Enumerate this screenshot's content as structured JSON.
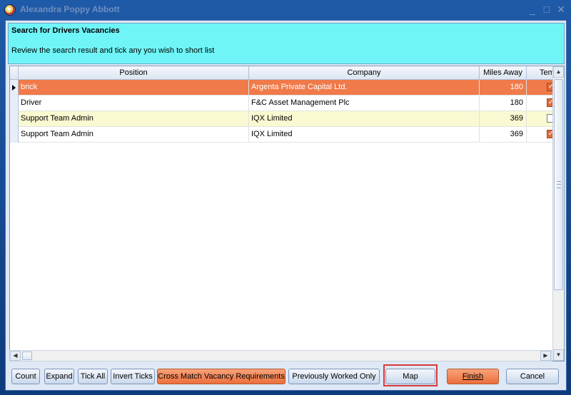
{
  "window": {
    "title": "Alexandra Poppy Abbott",
    "controls": [
      "_",
      "□",
      "✕"
    ]
  },
  "header": {
    "title": "Search for Drivers Vacancies",
    "subtitle": "Review the search result and tick any you wish to short list"
  },
  "grid": {
    "columns": [
      "Position",
      "Company",
      "Miles Away",
      "Tem"
    ],
    "rows": [
      {
        "position": "brick",
        "company": "Argenta Private Capital Ltd.",
        "miles": "180",
        "ticked": true,
        "selected": true
      },
      {
        "position": "Driver",
        "company": "F&C Asset Management Plc",
        "miles": "180",
        "ticked": true,
        "selected": false
      },
      {
        "position": "Support Team Admin",
        "company": "IQX Limited",
        "miles": "369",
        "ticked": false,
        "selected": false
      },
      {
        "position": "Support Team Admin",
        "company": "IQX Limited",
        "miles": "369",
        "ticked": true,
        "selected": false
      }
    ]
  },
  "buttons": {
    "count": "Count",
    "expand": "Expand",
    "tick_all": "Tick All",
    "invert_ticks": "Invert Ticks",
    "cross_match": "Cross Match Vacancy Requirements",
    "previously_worked": "Previously Worked Only",
    "map": "Map",
    "finish": "Finish",
    "cancel": "Cancel"
  },
  "colors": {
    "header_bg": "#6ff5f8",
    "selected_row": "#f07a4a",
    "alt_row": "#fafad2",
    "accent_orange": "#ec6f3c"
  }
}
